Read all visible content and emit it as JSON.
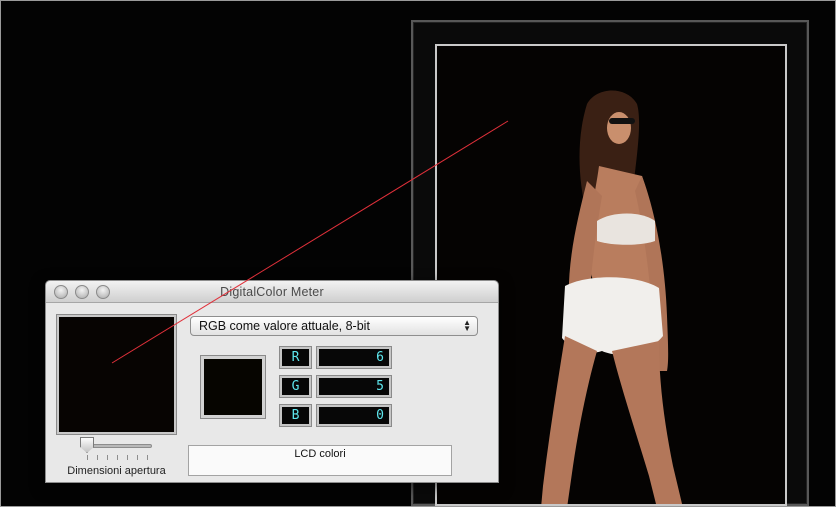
{
  "window": {
    "title": "DigitalColor Meter"
  },
  "controls": {
    "mode_label": "RGB come valore attuale, 8-bit",
    "aperture_label": "Dimensioni apertura",
    "aperture_level": 0,
    "lcd_label": "LCD colori"
  },
  "readout": {
    "channels": [
      {
        "label": "R",
        "value": "6"
      },
      {
        "label": "G",
        "value": "5"
      },
      {
        "label": "B",
        "value": "0"
      }
    ],
    "sample_color": "#060500"
  },
  "colors": {
    "readout_text": "#5ee7ee",
    "pointer_line": "#e0303a"
  },
  "icons": [
    "close-icon",
    "minimize-icon",
    "zoom-icon",
    "popup-arrows-icon"
  ]
}
